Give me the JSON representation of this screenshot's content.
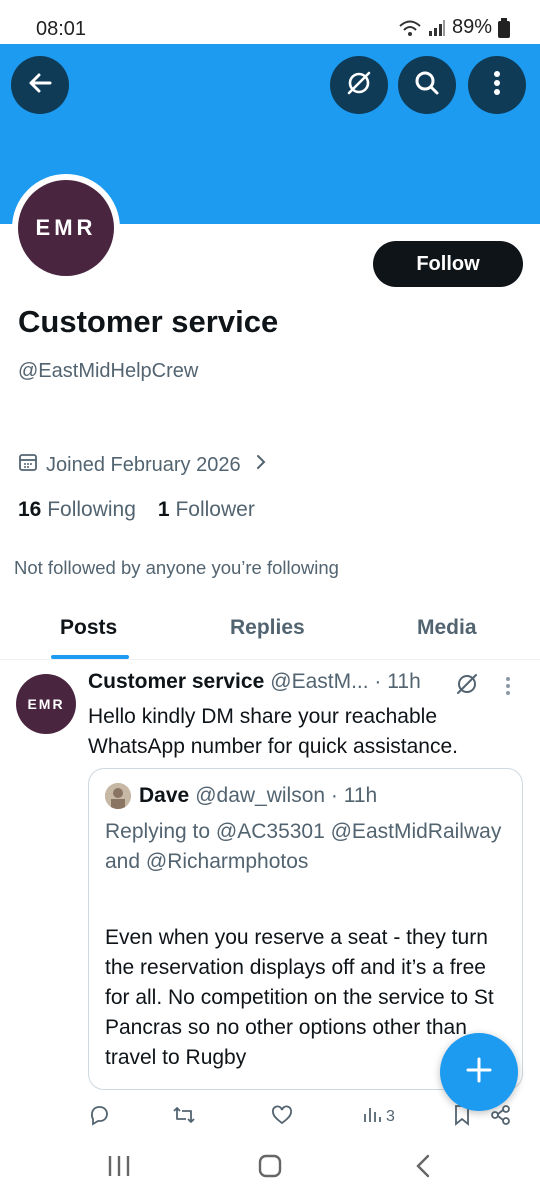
{
  "status_bar": {
    "time": "08:01",
    "battery": "89%"
  },
  "header": {
    "back_icon": "arrow-left-icon",
    "grok_icon": "grok-icon",
    "search_icon": "search-icon",
    "more_icon": "more-vertical-icon"
  },
  "profile": {
    "avatar_text": "EMR",
    "follow_label": "Follow",
    "display_name": "Customer service",
    "handle": "@EastMidHelpCrew",
    "joined": "Joined February 2026",
    "following_count": "16",
    "following_label": "Following",
    "followers_count": "1",
    "followers_label": "Follower",
    "not_followed": "Not followed by anyone you’re following"
  },
  "tabs": [
    {
      "label": "Posts",
      "active": true
    },
    {
      "label": "Replies",
      "active": false
    },
    {
      "label": "Media",
      "active": false
    }
  ],
  "post": {
    "avatar_text": "EMR",
    "name": "Customer service",
    "handle_time": "@EastM... · 11h",
    "text": "Hello kindly DM share your reachable WhatsApp number for quick assistance.",
    "quote": {
      "name": "Dave",
      "handle_time": "@daw_wilson · 11h",
      "replying": "Replying to @AC35301 @EastMidRailway and @Richarmphotos",
      "text": "Even when you reserve a seat - they turn the reservation displays off and it’s a free for all. No competition on the service to St Pancras so no other options other than travel to Rugby"
    },
    "actions": {
      "views": "3"
    }
  },
  "colors": {
    "accent": "#1d9bf0",
    "banner": "#1d9bf0",
    "brand": "#4a2540"
  }
}
